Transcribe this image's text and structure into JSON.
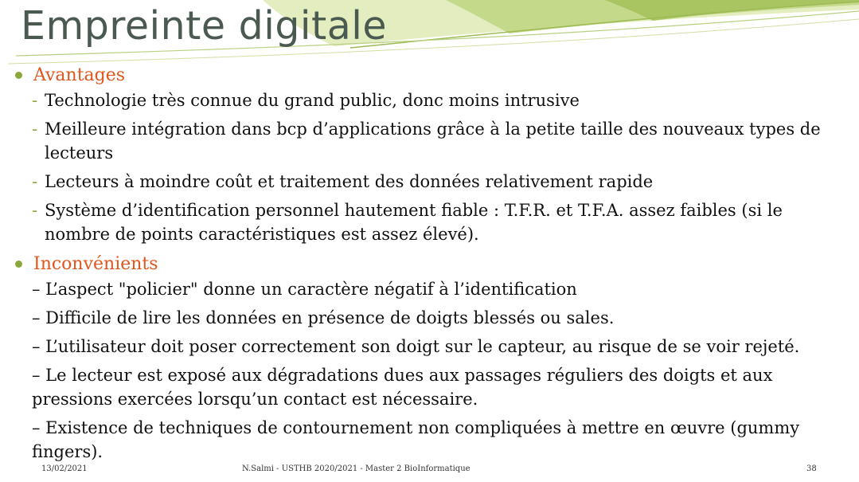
{
  "slide": {
    "title": "Empreinte digitale",
    "accent_color": "#e0561c",
    "green_color": "#8aa83c"
  },
  "advantages": {
    "label": "Avantages",
    "items": [
      "Technologie très connue du grand public, donc moins intrusive",
      "Meilleure intégration dans bcp d’applications grâce à la petite taille des nouveaux types de lecteurs",
      "Lecteurs à moindre coût  et traitement des données relativement rapide",
      "Système d’identification personnel hautement fiable : T.F.R. et T.F.A. assez faibles (si le nombre de points caractéristiques est assez élevé)."
    ]
  },
  "inconvenients": {
    "label": "Inconvénients",
    "items": [
      "– L’aspect \"policier\" donne un caractère négatif à l’identification",
      "– Difficile de lire les données en présence de doigts blessés ou sales.",
      "– L’utilisateur doit poser correctement son doigt sur le capteur, au risque de se voir rejeté.",
      "– Le lecteur est exposé aux dégradations dues aux passages réguliers des doigts et aux pressions exercées lorsqu’un contact est nécessaire.",
      "– Existence de techniques de contournement non compliquées à mettre en œuvre (gummy fingers)."
    ]
  },
  "footer": {
    "date": "13/02/2021",
    "center": "N.Salmi - USTHB 2020/2021 - Master 2 BioInformatique",
    "page": "38"
  }
}
